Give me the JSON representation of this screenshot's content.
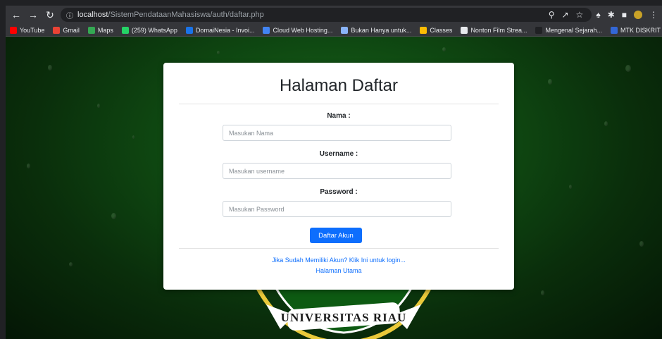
{
  "browser": {
    "url_host": "localhost",
    "url_path": "/SistemPendataanMahasiswa/auth/daftar.php",
    "bookmarks": [
      {
        "label": "YouTube",
        "color": "#ff0000"
      },
      {
        "label": "Gmail",
        "color": "#ea4335"
      },
      {
        "label": "Maps",
        "color": "#34a853"
      },
      {
        "label": "(259) WhatsApp",
        "color": "#25d366"
      },
      {
        "label": "DomaiNesia - Invoi...",
        "color": "#1a73e8"
      },
      {
        "label": "Cloud Web Hosting...",
        "color": "#4285f4"
      },
      {
        "label": "Bukan Hanya untuk...",
        "color": "#8ab4f8"
      },
      {
        "label": "Classes",
        "color": "#fbbc04"
      },
      {
        "label": "Nonton Film Strea...",
        "color": "#e8eaed"
      },
      {
        "label": "Mengenal Sejarah...",
        "color": "#202124"
      },
      {
        "label": "MTK DISKRIT | Prezi",
        "color": "#3367d6"
      }
    ]
  },
  "form": {
    "title": "Halaman Daftar",
    "nama_label": "Nama :",
    "nama_placeholder": "Masukan Nama",
    "username_label": "Username :",
    "username_placeholder": "Masukan username",
    "password_label": "Password :",
    "password_placeholder": "Masukan Password",
    "submit_label": "Daftar Akun",
    "login_link": "Jika Sudah Memiliki Akun? Klik Ini untuk login...",
    "home_link": "Halaman Utama"
  },
  "background": {
    "logo_text": "UNIVERSITAS RIAU",
    "accent": "#0d6efd"
  }
}
